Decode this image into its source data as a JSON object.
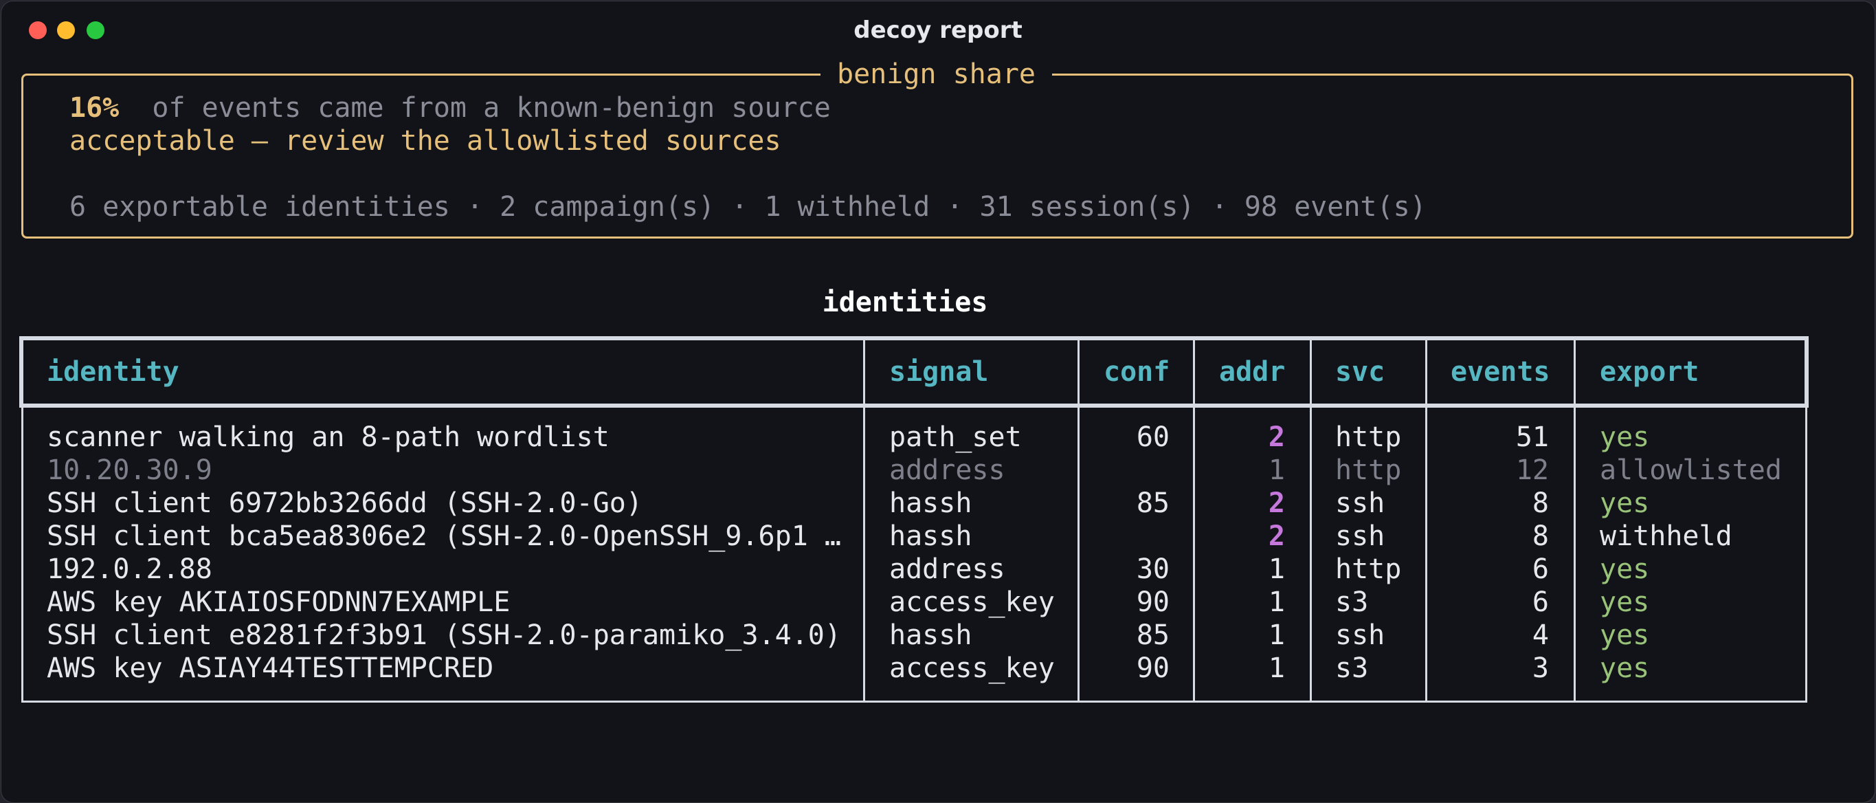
{
  "window": {
    "title": "decoy report"
  },
  "panel": {
    "legend": "benign share",
    "percent": "16%",
    "percent_text": "of events came from a known-benign source",
    "verdict": "acceptable — review the allowlisted sources",
    "summary": "6 exportable identities · 2 campaign(s) · 1 withheld · 31 session(s) · 98 event(s)"
  },
  "table": {
    "title": "identities",
    "headers": [
      "identity",
      "signal",
      "conf",
      "addr",
      "svc",
      "events",
      "export"
    ],
    "rows": [
      {
        "identity": "scanner walking an 8-path wordlist",
        "signal": "path_set",
        "conf": "60",
        "addr": "2",
        "svc": "http",
        "events": "51",
        "export": "yes",
        "style": "normal",
        "addr_highlight": true
      },
      {
        "identity": "10.20.30.9",
        "signal": "address",
        "conf": "",
        "addr": "1",
        "svc": "http",
        "events": "12",
        "export": "allowlisted",
        "style": "dim",
        "addr_highlight": false
      },
      {
        "identity": "SSH client 6972bb3266dd (SSH-2.0-Go)",
        "signal": "hassh",
        "conf": "85",
        "addr": "2",
        "svc": "ssh",
        "events": "8",
        "export": "yes",
        "style": "normal",
        "addr_highlight": true
      },
      {
        "identity": "SSH client bca5ea8306e2 (SSH-2.0-OpenSSH_9.6p1 …",
        "signal": "hassh",
        "conf": "",
        "addr": "2",
        "svc": "ssh",
        "events": "8",
        "export": "withheld",
        "style": "amber",
        "addr_highlight": true
      },
      {
        "identity": "192.0.2.88",
        "signal": "address",
        "conf": "30",
        "addr": "1",
        "svc": "http",
        "events": "6",
        "export": "yes",
        "style": "normal",
        "addr_highlight": false
      },
      {
        "identity": "AWS key AKIAIOSFODNN7EXAMPLE",
        "signal": "access_key",
        "conf": "90",
        "addr": "1",
        "svc": "s3",
        "events": "6",
        "export": "yes",
        "style": "normal",
        "addr_highlight": false
      },
      {
        "identity": "SSH client e8281f2f3b91 (SSH-2.0-paramiko_3.4.0)",
        "signal": "hassh",
        "conf": "85",
        "addr": "1",
        "svc": "ssh",
        "events": "4",
        "export": "yes",
        "style": "normal",
        "addr_highlight": false
      },
      {
        "identity": "AWS key ASIAY44TESTTEMPCRED",
        "signal": "access_key",
        "conf": "90",
        "addr": "1",
        "svc": "s3",
        "events": "3",
        "export": "yes",
        "style": "normal",
        "addr_highlight": false
      }
    ]
  },
  "colors": {
    "accent_amber": "#e6c07b",
    "header_cyan": "#56b6c2",
    "highlight_purple": "#c678dd",
    "yes_green": "#98c379",
    "dim_gray": "#7d808a"
  }
}
